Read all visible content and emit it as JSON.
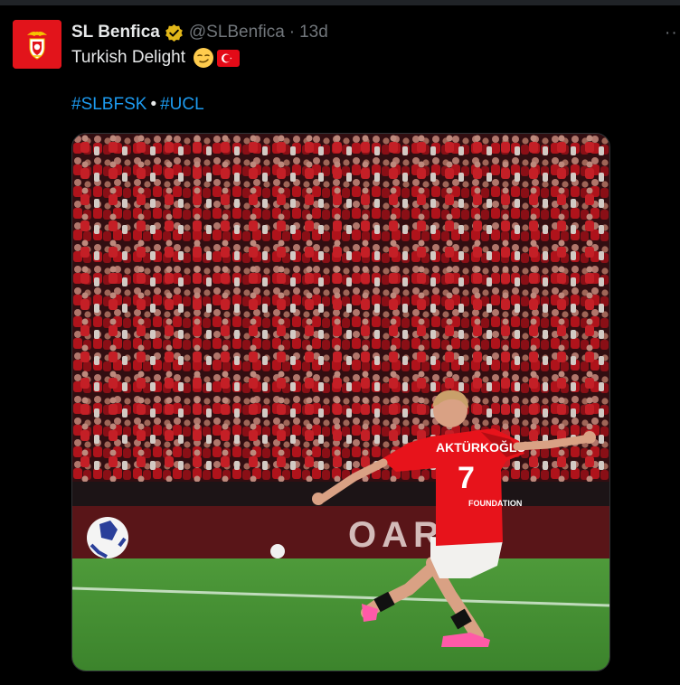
{
  "window": {
    "accent": "#1d9bf0",
    "background": "#000000"
  },
  "tweet": {
    "display_name": "SL Benfica",
    "verified_badge": "gold-verified-icon",
    "handle": "@SLBenfica",
    "separator": "·",
    "time": "13d",
    "text": "Turkish Delight",
    "emojis": [
      "smirking-face-icon",
      "turkey-flag-icon"
    ],
    "hashtags": [
      "#SLBFSK",
      "#UCL"
    ],
    "hashtag_separator": "•",
    "more_label": "··"
  },
  "media": {
    "image_description_label": "",
    "player_name": "AKTÜRKOĞLU",
    "player_number": "7",
    "shirt_sponsor": "FOUNDATION",
    "board_text": "OAR A"
  }
}
